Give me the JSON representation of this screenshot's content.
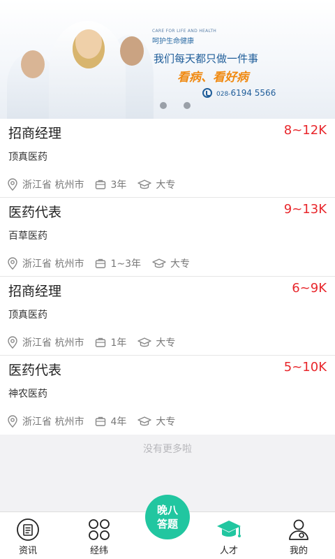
{
  "banner": {
    "small_text": "CARE FOR LIFE AND HEALTH",
    "care_text": "呵护生命健康",
    "slogan_1": "我们每天都只做一件事",
    "slogan_2": "看病、看好病",
    "phone_prefix": "028-",
    "phone_number": "6194 5566",
    "slide_count": 2,
    "active_slide": 0
  },
  "jobs": [
    {
      "title": "招商经理",
      "salary": "8~12K",
      "company": "顶真医药",
      "location": "浙江省 杭州市",
      "experience": "3年",
      "education": "大专"
    },
    {
      "title": "医药代表",
      "salary": "9~13K",
      "company": "百草医药",
      "location": "浙江省 杭州市",
      "experience": "1~3年",
      "education": "大专"
    },
    {
      "title": "招商经理",
      "salary": "6~9K",
      "company": "顶真医药",
      "location": "浙江省 杭州市",
      "experience": "1年",
      "education": "大专"
    },
    {
      "title": "医药代表",
      "salary": "5~10K",
      "company": "神农医药",
      "location": "浙江省 杭州市",
      "experience": "4年",
      "education": "大专"
    }
  ],
  "no_more_text": "没有更多啦",
  "tabbar": {
    "tabs": [
      {
        "label": "资讯",
        "icon": "news-icon"
      },
      {
        "label": "经纬",
        "icon": "grid-icon"
      },
      {
        "label": "人才",
        "icon": "graduation-cap-icon",
        "active": true
      },
      {
        "label": "我的",
        "icon": "user-icon"
      }
    ],
    "center_line1": "晚八",
    "center_line2": "答题",
    "accent_color": "#21c6a0"
  },
  "colors": {
    "salary": "#e8262b",
    "tab_active": "#21c6a0"
  }
}
